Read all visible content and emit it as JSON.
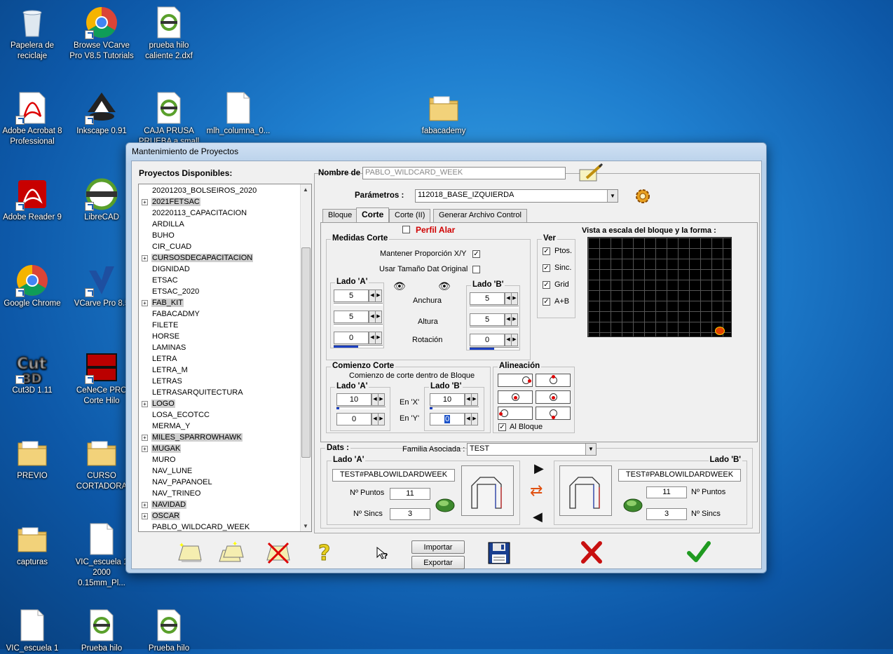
{
  "desktop": {
    "icons": [
      {
        "label": "Papelera de reciclaje",
        "icon": "recycle-bin-icon"
      },
      {
        "label": "Browse VCarve Pro V8.5 Tutorials",
        "icon": "chrome-icon"
      },
      {
        "label": "prueba hilo caliente 2.dxf",
        "icon": "librecad-file-icon"
      },
      {
        "label": "Adobe Acrobat 8 Professional",
        "icon": "acrobat-icon"
      },
      {
        "label": "Inkscape 0.91",
        "icon": "inkscape-icon"
      },
      {
        "label": "CAJA PRUSA PRUEBA a small",
        "icon": "librecad-file-icon"
      },
      {
        "label": "mlh_columna_0...",
        "icon": "file-icon"
      },
      {
        "label": "fabacademy",
        "icon": "folder-icon"
      },
      {
        "label": "Adobe Reader 9",
        "icon": "reader-icon"
      },
      {
        "label": "LibreCAD",
        "icon": "librecad-icon"
      },
      {
        "label": "Google Chrome",
        "icon": "chrome-icon"
      },
      {
        "label": "VCarve Pro 8.5",
        "icon": "vcarve-icon"
      },
      {
        "label": "Cut3D 1.11",
        "icon": "cut3d-icon"
      },
      {
        "label": "CeNeCe PRO Corte Hilo",
        "icon": "cenece-icon"
      },
      {
        "label": "PREVIO",
        "icon": "folder-icon"
      },
      {
        "label": "CURSO CORTADORA",
        "icon": "folder-icon"
      },
      {
        "label": "capturas",
        "icon": "folder-icon"
      },
      {
        "label": "VIC_escuela 1 2000 0.15mm_Pl...",
        "icon": "file-icon"
      },
      {
        "label": "VIC_escuela 1",
        "icon": "file-icon"
      },
      {
        "label": "Prueba hilo",
        "icon": "librecad-file-icon"
      },
      {
        "label": "Prueba hilo",
        "icon": "librecad-file-icon"
      }
    ]
  },
  "window": {
    "title": "Mantenimiento de Proyectos",
    "projects_header": "Proyectos Disponibles:",
    "projects": [
      {
        "name": "20201203_BOLSEIROS_2020",
        "expand": false,
        "hl": false
      },
      {
        "name": "2021FETSAC",
        "expand": true,
        "hl": true
      },
      {
        "name": "20220113_CAPACITACION",
        "expand": false,
        "hl": false
      },
      {
        "name": "ARDILLA",
        "expand": false,
        "hl": false
      },
      {
        "name": "BUHO",
        "expand": false,
        "hl": false
      },
      {
        "name": "CIR_CUAD",
        "expand": false,
        "hl": false
      },
      {
        "name": "CURSOSDECAPACITACION",
        "expand": true,
        "hl": true
      },
      {
        "name": "DIGNIDAD",
        "expand": false,
        "hl": false
      },
      {
        "name": "ETSAC",
        "expand": false,
        "hl": false
      },
      {
        "name": "ETSAC_2020",
        "expand": false,
        "hl": false
      },
      {
        "name": "FAB_KIT",
        "expand": true,
        "hl": true
      },
      {
        "name": "FABACADMY",
        "expand": false,
        "hl": false
      },
      {
        "name": "FILETE",
        "expand": false,
        "hl": false
      },
      {
        "name": "HORSE",
        "expand": false,
        "hl": false
      },
      {
        "name": "LAMINAS",
        "expand": false,
        "hl": false
      },
      {
        "name": "LETRA",
        "expand": false,
        "hl": false
      },
      {
        "name": "LETRA_M",
        "expand": false,
        "hl": false
      },
      {
        "name": "LETRAS",
        "expand": false,
        "hl": false
      },
      {
        "name": "LETRASARQUITECTURA",
        "expand": false,
        "hl": false
      },
      {
        "name": "LOGO",
        "expand": true,
        "hl": true
      },
      {
        "name": "LOSA_ECOTCC",
        "expand": false,
        "hl": false
      },
      {
        "name": "MERMA_Y",
        "expand": false,
        "hl": false
      },
      {
        "name": "MILES_SPARROWHAWK",
        "expand": true,
        "hl": true
      },
      {
        "name": "MUGAK",
        "expand": true,
        "hl": true
      },
      {
        "name": "MURO",
        "expand": false,
        "hl": false
      },
      {
        "name": "NAV_LUNE",
        "expand": false,
        "hl": false
      },
      {
        "name": "NAV_PAPANOEL",
        "expand": false,
        "hl": false
      },
      {
        "name": "NAV_TRINEO",
        "expand": false,
        "hl": false
      },
      {
        "name": "NAVIDAD",
        "expand": true,
        "hl": true
      },
      {
        "name": "OSCAR",
        "expand": true,
        "hl": true
      },
      {
        "name": "PABLO_WILDCARD_WEEK",
        "expand": false,
        "hl": false
      }
    ],
    "nombre_label": "Nombre de",
    "nombre_value": "PABLO_WILDCARD_WEEK",
    "parametros_label": "Parámetros :",
    "parametros_value": "112018_BASE_IZQUIERDA",
    "tabs": [
      "Bloque",
      "Corte",
      "Corte (II)",
      "Generar Archivo Control"
    ],
    "perfil_alar": "Perfil Alar",
    "medidas": {
      "title": "Medidas Corte",
      "mantener": "Mantener Proporción X/Y",
      "usar": "Usar Tamaño Dat Original",
      "lado_a": "Lado 'A'",
      "lado_b": "Lado 'B'",
      "anchura": "Anchura",
      "altura": "Altura",
      "rotacion": "Rotación",
      "a_anchura": "5",
      "a_altura": "5",
      "a_rotacion": "0",
      "b_anchura": "5",
      "b_altura": "5",
      "b_rotacion": "0"
    },
    "ver": {
      "title": "Ver",
      "ptos": "Ptos.",
      "sinc": "Sinc.",
      "grid": "Grid",
      "ab": "A+B"
    },
    "vista_label": "Vista a escala del bloque y la forma :",
    "comienzo": {
      "title": "Comienzo Corte",
      "subtitle": "Comienzo de corte dentro de Bloque",
      "lado_a": "Lado 'A'",
      "lado_b": "Lado 'B'",
      "en_x": "En 'X'",
      "en_y": "En 'Y'",
      "a_x": "10",
      "a_y": "0",
      "b_x": "10",
      "b_y": "0"
    },
    "alineacion": {
      "title": "Alineación",
      "al_bloque": "Al Bloque"
    },
    "dats": {
      "title": "Dats :",
      "familia_label": "Familia Asociada :",
      "familia_value": "TEST",
      "lado_a": "Lado 'A'",
      "lado_b": "Lado 'B'",
      "a_name": "TEST#PABLOWILDARDWEEK",
      "b_name": "TEST#PABLOWILDARDWEEK",
      "n_puntos": "Nº Puntos",
      "n_sincs": "Nº Sincs",
      "a_puntos": "11",
      "a_sincs": "3",
      "b_puntos": "11",
      "b_sincs": "3"
    },
    "buttons": {
      "importar": "Importar",
      "exportar": "Exportar"
    }
  }
}
